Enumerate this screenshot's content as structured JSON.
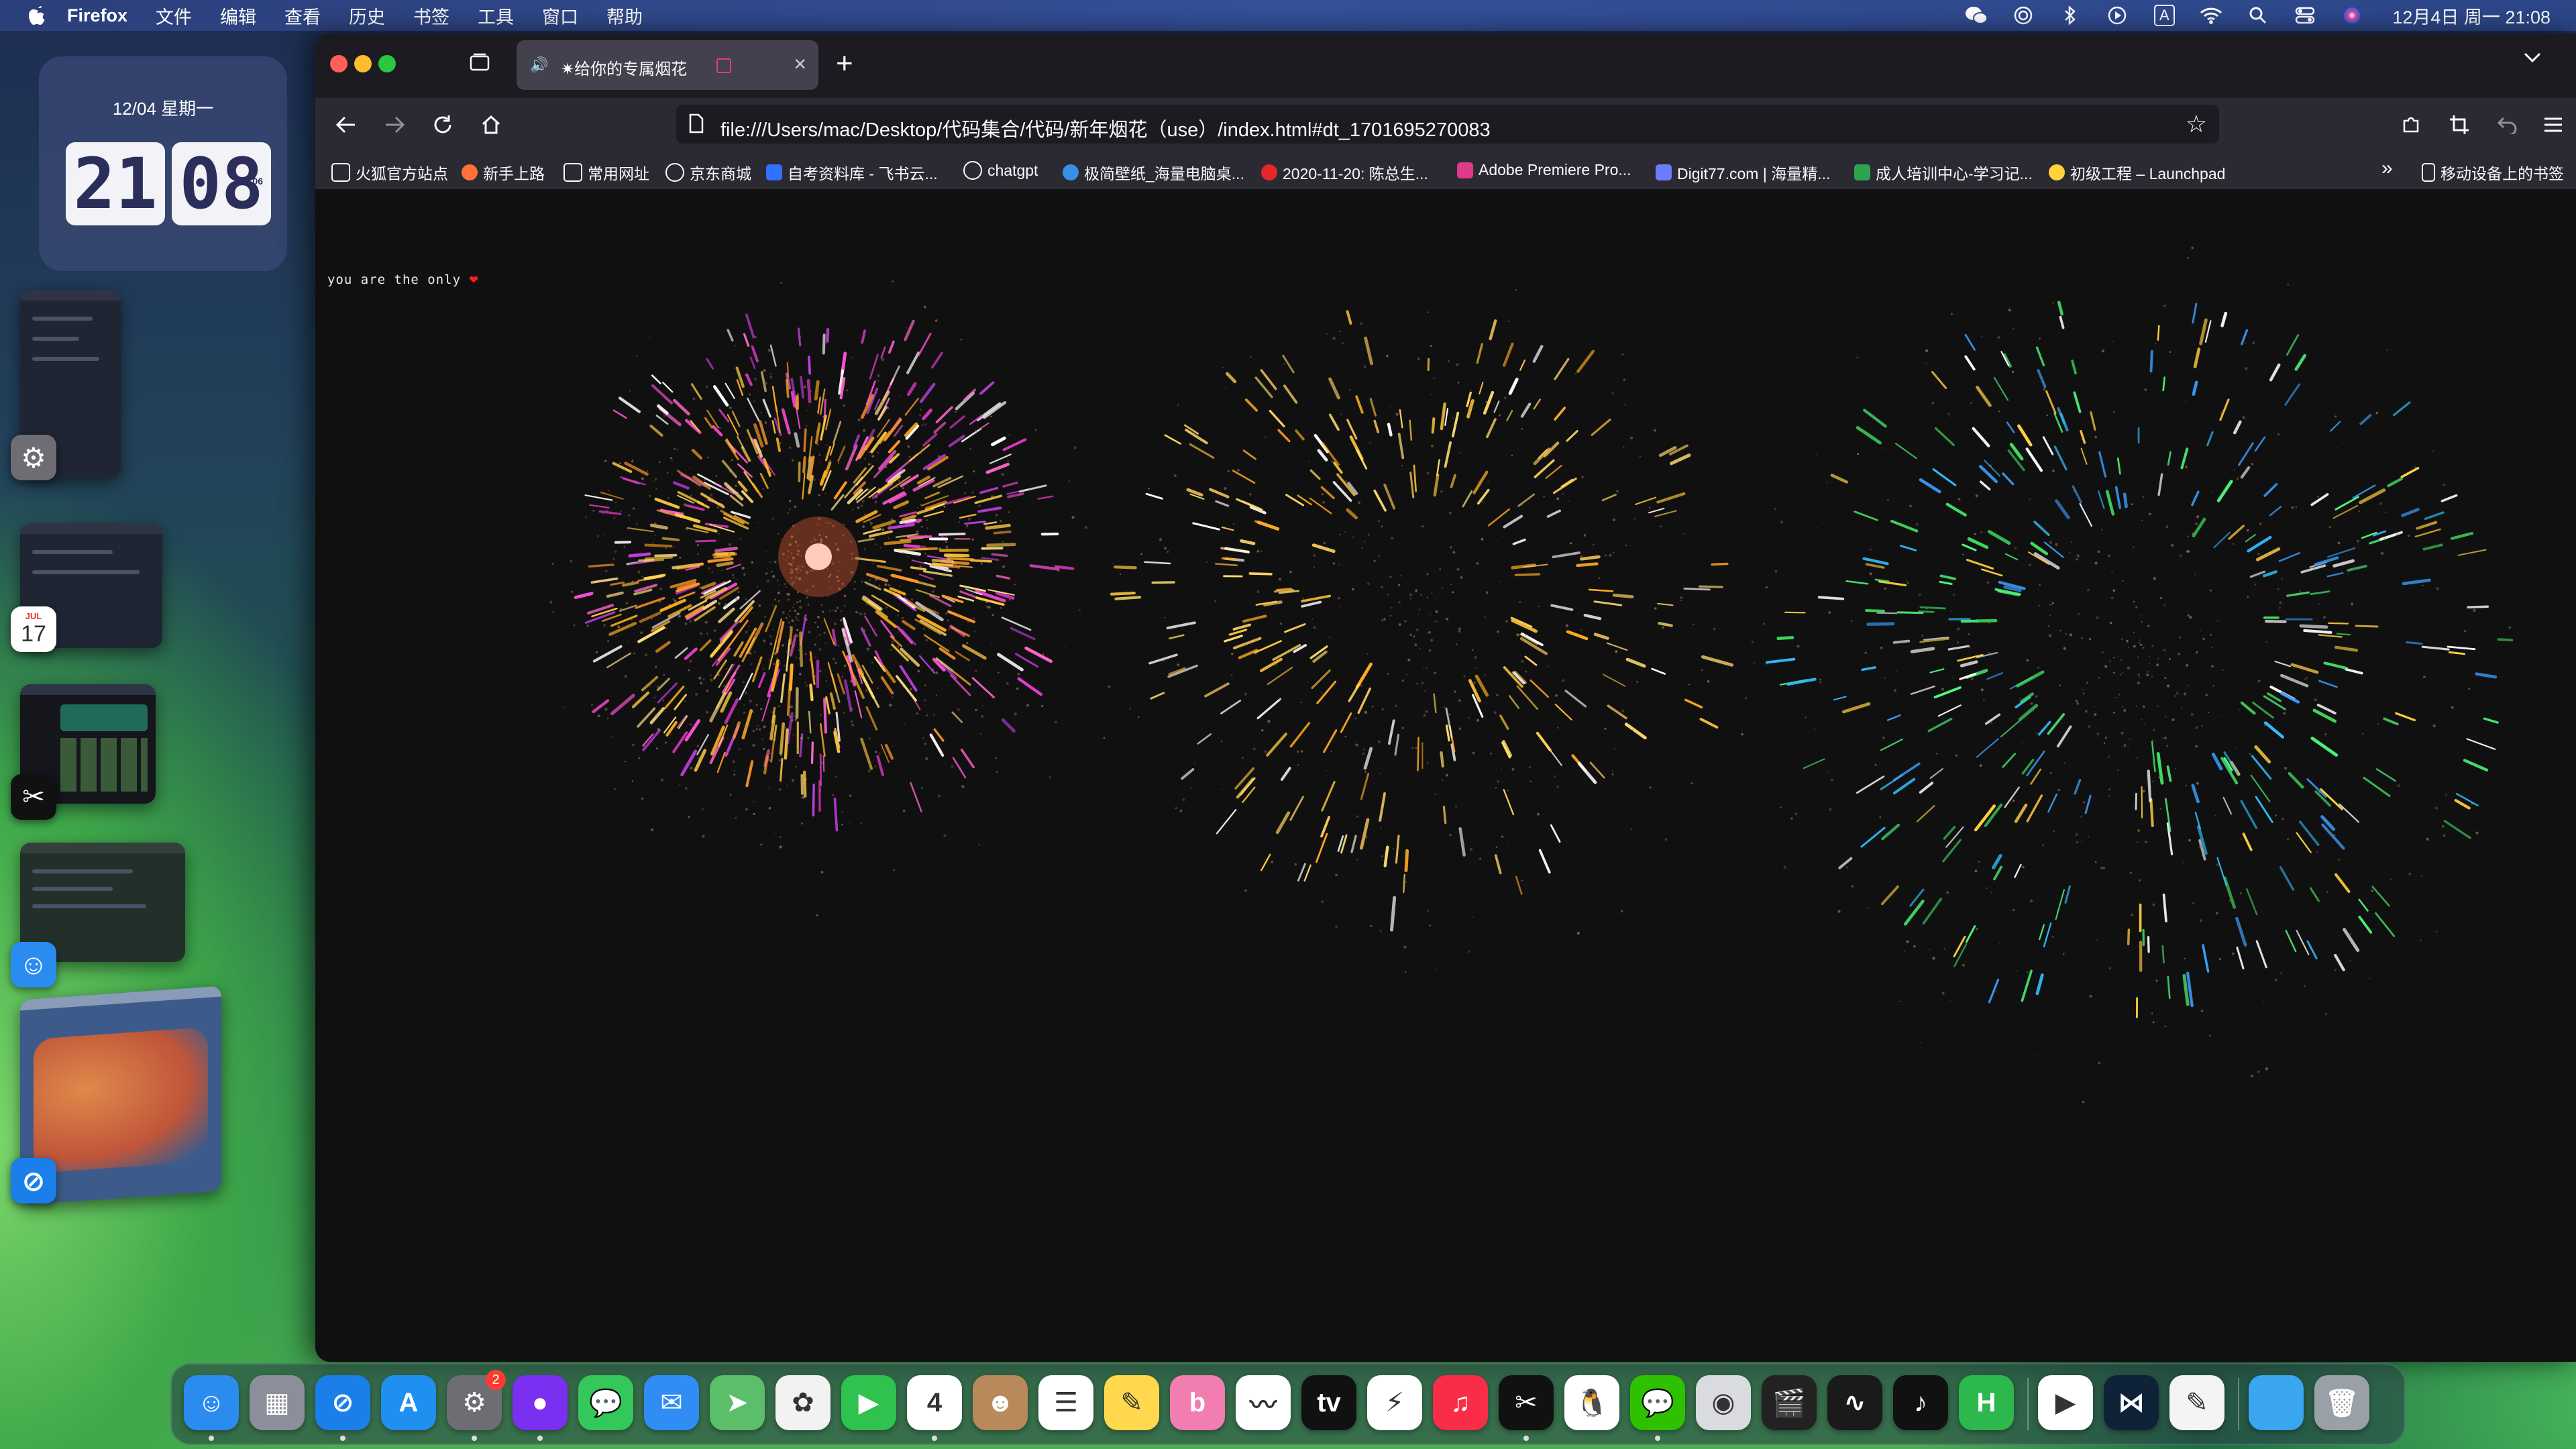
{
  "menubar": {
    "app_name": "Firefox",
    "items": [
      "文件",
      "编辑",
      "查看",
      "历史",
      "书签",
      "工具",
      "窗口",
      "帮助"
    ],
    "clock": "12月4日 周一 21:08",
    "input_indicator": "A"
  },
  "widget": {
    "date": "12/04 星期一",
    "hour": "21",
    "minute": "08",
    "second": "06"
  },
  "browser": {
    "tab": {
      "title": "✷给你的专属烟花",
      "audio_icon": "speaker-icon"
    },
    "url": "file:///Users/mac/Desktop/代码集合/代码/新年烟花（use）/index.html#dt_1701695270083",
    "bookmarks": [
      {
        "label": "火狐官方站点",
        "icon": "folder-icon",
        "color": "#fbfbfe"
      },
      {
        "label": "新手上路",
        "icon": "firefox-icon",
        "color": "#ff7139"
      },
      {
        "label": "常用网址",
        "icon": "folder-icon",
        "color": "#fbfbfe"
      },
      {
        "label": "京东商城",
        "icon": "globe-icon",
        "color": "#fbfbfe"
      },
      {
        "label": "自考资料库 - 飞书云...",
        "icon": "feishu-icon",
        "color": "#3370ff"
      },
      {
        "label": "chatgpt",
        "icon": "openai-icon",
        "color": "#fbfbfe"
      },
      {
        "label": "极简壁纸_海量电脑桌...",
        "icon": "wallpaper-icon",
        "color": "#3a8ee6"
      },
      {
        "label": "2020-11-20: 陈总生...",
        "icon": "g-icon",
        "color": "#e5262b"
      },
      {
        "label": "Adobe Premiere Pro...",
        "icon": "adobe-icon",
        "color": "#e03a8a"
      },
      {
        "label": "Digit77.com | 海量精...",
        "icon": "digit-icon",
        "color": "#6b7cff"
      },
      {
        "label": "成人培训中心-学习记...",
        "icon": "edu-icon",
        "color": "#2ea44f"
      },
      {
        "label": "初级工程 – Launchpad",
        "icon": "launchpad-icon",
        "color": "#ffd43b"
      }
    ],
    "mobile_bookmarks": "移动设备上的书签",
    "page": {
      "overlay_text": "you are the only",
      "heart": "❤"
    }
  },
  "dock": {
    "apps": [
      {
        "name": "Finder",
        "icon": "finder-icon",
        "color": "#2b8cf0",
        "glyph": "☺",
        "running": true
      },
      {
        "name": "Launchpad",
        "icon": "launchpad-icon",
        "color": "#8c8f99",
        "glyph": "▦",
        "running": false
      },
      {
        "name": "Safari",
        "icon": "safari-icon",
        "color": "#1a7fe8",
        "glyph": "⊘",
        "running": true
      },
      {
        "name": "App Store",
        "icon": "appstore-icon",
        "color": "#1f8ff0",
        "glyph": "A",
        "running": false
      },
      {
        "name": "System Settings",
        "icon": "settings-icon",
        "color": "#6d6d73",
        "glyph": "⚙",
        "running": true,
        "badge": "2"
      },
      {
        "name": "Firefox",
        "icon": "firefox-icon",
        "color": "#7b2ff0",
        "glyph": "●",
        "running": true
      },
      {
        "name": "Messages",
        "icon": "messages-icon",
        "color": "#34c759",
        "glyph": "💬",
        "running": false
      },
      {
        "name": "Mail",
        "icon": "mail-icon",
        "color": "#2f8df5",
        "glyph": "✉",
        "running": false
      },
      {
        "name": "Maps",
        "icon": "maps-icon",
        "color": "#5bbf6a",
        "glyph": "➤",
        "running": false
      },
      {
        "name": "Photos",
        "icon": "photos-icon",
        "color": "#f2f2f2",
        "glyph": "✿",
        "running": false
      },
      {
        "name": "FaceTime",
        "icon": "facetime-icon",
        "color": "#2fc24e",
        "glyph": "▶",
        "running": false
      },
      {
        "name": "Calendar",
        "icon": "calendar-icon",
        "color": "#ffffff",
        "glyph": "4",
        "running": true
      },
      {
        "name": "Contacts",
        "icon": "contacts-icon",
        "color": "#b8895a",
        "glyph": "☻",
        "running": false
      },
      {
        "name": "Reminders",
        "icon": "reminders-icon",
        "color": "#ffffff",
        "glyph": "☰",
        "running": false
      },
      {
        "name": "Notes",
        "icon": "notes-icon",
        "color": "#ffd84d",
        "glyph": "✎",
        "running": false
      },
      {
        "name": "Bilibili",
        "icon": "bilibili-icon",
        "color": "#f27db0",
        "glyph": "b",
        "running": false
      },
      {
        "name": "Freeform",
        "icon": "freeform-icon",
        "color": "#ffffff",
        "glyph": "〰",
        "running": false
      },
      {
        "name": "Apple TV",
        "icon": "appletv-icon",
        "color": "#111111",
        "glyph": "tv",
        "running": false
      },
      {
        "name": "Feishu",
        "icon": "feishu-icon",
        "color": "#ffffff",
        "glyph": "⚡",
        "running": false
      },
      {
        "name": "Music",
        "icon": "music-icon",
        "color": "#fa2d48",
        "glyph": "♫",
        "running": false
      },
      {
        "name": "CapCut",
        "icon": "capcut-icon",
        "color": "#111111",
        "glyph": "✂",
        "running": true
      },
      {
        "name": "QQ",
        "icon": "qq-icon",
        "color": "#ffffff",
        "glyph": "🐧",
        "running": false
      },
      {
        "name": "WeChat",
        "icon": "wechat-icon",
        "color": "#2dc100",
        "glyph": "💬",
        "running": true
      },
      {
        "name": "Preview",
        "icon": "preview-icon",
        "color": "#d9dbe0",
        "glyph": "◉",
        "running": false
      },
      {
        "name": "Final Cut Pro",
        "icon": "finalcut-icon",
        "color": "#222222",
        "glyph": "🎬",
        "running": false
      },
      {
        "name": "Activity Monitor",
        "icon": "activity-icon",
        "color": "#1a1a1a",
        "glyph": "∿",
        "running": false
      },
      {
        "name": "TikTok",
        "icon": "tiktok-icon",
        "color": "#111111",
        "glyph": "♪",
        "running": false
      },
      {
        "name": "HBuilder",
        "icon": "hbuilder-icon",
        "color": "#2db84d",
        "glyph": "H",
        "running": false
      },
      {
        "name": "Infuse",
        "icon": "infuse-icon",
        "color": "#ffffff",
        "glyph": "▶",
        "running": false
      },
      {
        "name": "VS Code",
        "icon": "vscode-icon",
        "color": "#0e2238",
        "glyph": "⋈",
        "running": false
      },
      {
        "name": "TextEdit",
        "icon": "textedit-icon",
        "color": "#f4f4f4",
        "glyph": "✎",
        "running": false
      },
      {
        "name": "macOS Folder",
        "icon": "folder-icon",
        "color": "#3aa6f0",
        "glyph": "",
        "running": false
      },
      {
        "name": "Trash",
        "icon": "trash-icon",
        "color": "#9aa0a8",
        "glyph": "🗑",
        "running": false
      }
    ]
  },
  "stage_manager": {
    "calendar_day": "17",
    "calendar_month": "JUL"
  }
}
